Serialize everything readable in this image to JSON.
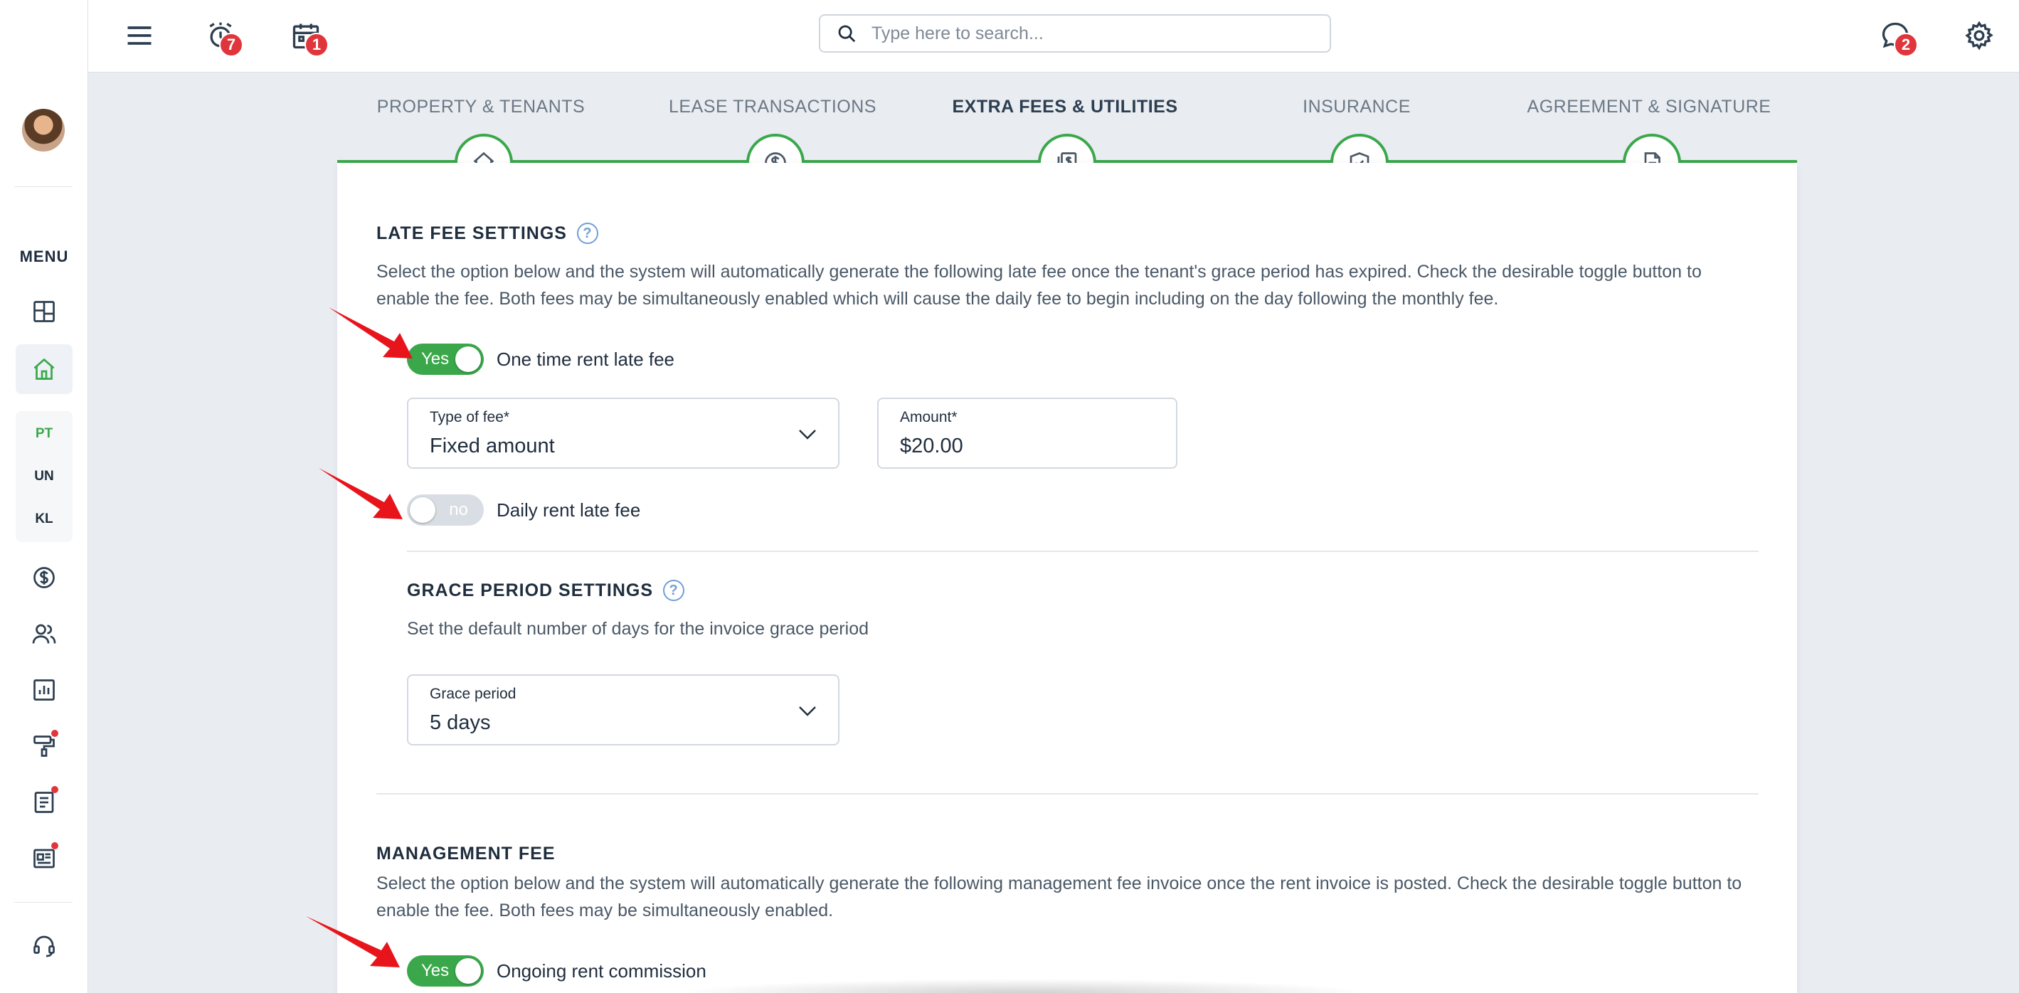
{
  "sidebar": {
    "menu_label": "MENU",
    "items": [
      {
        "name": "dashboard",
        "icon": "dashboard-icon"
      },
      {
        "name": "properties",
        "icon": "home-icon",
        "active": true
      },
      {
        "name": "payments",
        "icon": "dollar-icon"
      },
      {
        "name": "people",
        "icon": "people-icon"
      },
      {
        "name": "reports",
        "icon": "chart-icon"
      },
      {
        "name": "maintenance",
        "icon": "paint-roller-icon",
        "dot": true
      },
      {
        "name": "documents",
        "icon": "document-icon",
        "dot": true
      },
      {
        "name": "news",
        "icon": "newspaper-icon",
        "dot": true
      },
      {
        "name": "support",
        "icon": "headset-icon"
      }
    ],
    "abbreviations": [
      "PT",
      "UN",
      "KL"
    ]
  },
  "topbar": {
    "alarm_badge": "7",
    "calendar_badge": "1",
    "messages_badge": "2",
    "search_placeholder": "Type here to search..."
  },
  "steps": [
    {
      "label": "PROPERTY & TENANTS",
      "icon": "house-icon"
    },
    {
      "label": "LEASE TRANSACTIONS",
      "icon": "dollar-icon"
    },
    {
      "label": "EXTRA FEES & UTILITIES",
      "icon": "bills-icon",
      "current": true
    },
    {
      "label": "INSURANCE",
      "icon": "shield-icon"
    },
    {
      "label": "AGREEMENT & SIGNATURE",
      "icon": "document-icon"
    }
  ],
  "late_fee": {
    "title": "LATE FEE SETTINGS",
    "help": "?",
    "description_line1": "Select the option below and the system will automatically generate the following late fee once the tenant's grace period has expired. Check the desirable toggle button to",
    "description_line2": "enable the fee. Both fees may be simultaneously enabled which will cause the daily fee to begin including on the day following the monthly fee.",
    "one_time_toggle": {
      "state": "Yes",
      "label": "One time rent late fee"
    },
    "type_of_fee": {
      "label": "Type of fee*",
      "value": "Fixed amount"
    },
    "amount": {
      "label": "Amount*",
      "value": "$20.00"
    },
    "daily_toggle": {
      "state": "no",
      "label": "Daily rent late fee"
    }
  },
  "grace_period": {
    "title": "GRACE PERIOD SETTINGS",
    "help": "?",
    "description": "Set the default number of days for the invoice grace period",
    "field": {
      "label": "Grace period",
      "value": "5 days"
    }
  },
  "management_fee": {
    "title": "MANAGEMENT FEE",
    "description_line1": "Select the option below and the system will automatically generate the following management fee invoice once the rent invoice is posted. Check the desirable toggle button to",
    "description_line2": "enable the fee. Both fees may be simultaneously enabled.",
    "ongoing_toggle": {
      "state": "Yes",
      "label": "Ongoing rent commission"
    }
  },
  "colors": {
    "accent_green": "#3aa84a",
    "badge_red": "#e0353b",
    "help_blue": "#6f9fd8",
    "annotation_arrow": "#e8141b"
  }
}
